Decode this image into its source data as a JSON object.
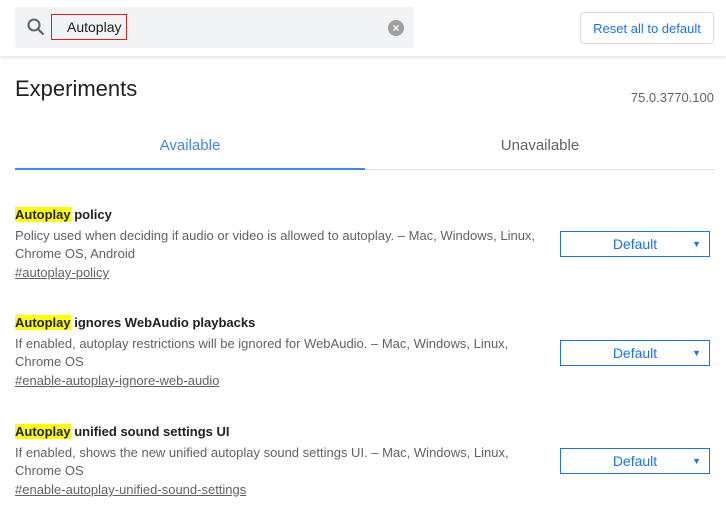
{
  "search": {
    "value": "Autoplay",
    "icon": "search-icon",
    "clear_icon": "close-icon"
  },
  "reset_label": "Reset all to default",
  "title": "Experiments",
  "version": "75.0.3770.100",
  "tabs": [
    {
      "label": "Available"
    },
    {
      "label": "Unavailable"
    }
  ],
  "highlight_color": "#ffff00",
  "experiments": [
    {
      "highlight": "Autoplay",
      "name_rest": " policy",
      "desc": "Policy used when deciding if audio or video is allowed to autoplay. – Mac, Windows, Linux, Chrome OS, Android",
      "link": "#autoplay-policy",
      "value": "Default"
    },
    {
      "highlight": "Autoplay",
      "name_rest": " ignores WebAudio playbacks",
      "desc": "If enabled, autoplay restrictions will be ignored for WebAudio. – Mac, Windows, Linux, Chrome OS",
      "link": "#enable-autoplay-ignore-web-audio",
      "value": "Default"
    },
    {
      "highlight": "Autoplay",
      "name_rest": " unified sound settings UI",
      "desc": "If enabled, shows the new unified autoplay sound settings UI. – Mac, Windows, Linux, Chrome OS",
      "link": "#enable-autoplay-unified-sound-settings",
      "value": "Default"
    }
  ]
}
